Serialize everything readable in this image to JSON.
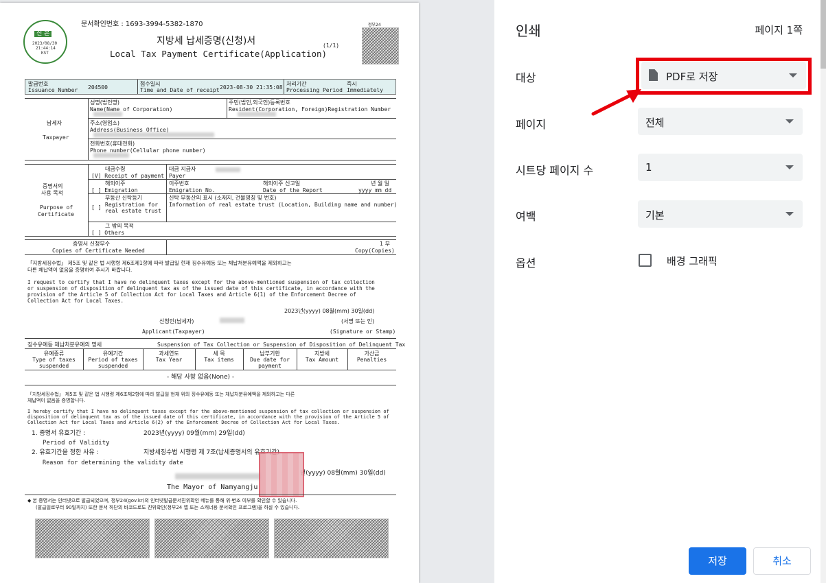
{
  "print": {
    "title": "인쇄",
    "page_count": "페이지 1쪽",
    "destination": {
      "label": "대상",
      "value": "PDF로 저장"
    },
    "pages": {
      "label": "페이지",
      "value": "전체"
    },
    "pages_per_sheet": {
      "label": "시트당 페이지 수",
      "value": "1"
    },
    "margins": {
      "label": "여백",
      "value": "기본"
    },
    "options": {
      "label": "옵션",
      "checkbox_label": "배경 그래픽"
    },
    "save_button": "저장",
    "cancel_button": "취소",
    "highlight_color": "#e8000b",
    "accent_color": "#1a73e8"
  },
  "doc": {
    "doc_number": "문서확인번호 :  1693-3994-5382-1870",
    "title_ko": "지방세 납세증명(신청)서",
    "title_en": "Local Tax Payment Certificate(Application)",
    "page_of": "(1/1)",
    "seal": {
      "top": "진 본",
      "date": "2023/08/30",
      "time": "21:44:14",
      "tz": "KST"
    },
    "gov24": "정부24",
    "issuance_number_ko": "발급번호",
    "issuance_number_en": "Issuance Number",
    "issuance_number": "204500",
    "receipt_ko": "접수일시",
    "receipt_en": "Time and Date of receipt",
    "receipt_time": "2023-08-30 21:35:08",
    "period_ko": "처리기간",
    "period_en": "Processing Period",
    "period_ko_val": "즉시",
    "period_en_val": "Immediately",
    "taxpayer_ko": "납세자",
    "taxpayer_en": "Taxpayer",
    "name_ko": "성명(법인명)",
    "name_en": "Name(Name of Corporation)",
    "reg_ko": "주민(법인,외국인)등록번호",
    "reg_en": "Resident(Corporation, Foreign)Registration Number",
    "addr_ko": "주소(영업소)",
    "addr_en": "Address(Business Office)",
    "phone_ko": "전화번호(휴대전화)",
    "phone_en": "Phone number(Cellular phone number)",
    "purpose_ko1": "증명서의",
    "purpose_ko2": "사용 목적",
    "purpose_en1": "Purpose of",
    "purpose_en2": "Certificate",
    "receipt_pay_ko": "대금수령",
    "receipt_pay_en": "[V] Receipt of payment",
    "payer_ko": "대금 지급자",
    "payer_en": "Payer",
    "emig_ko": "해외이주",
    "emig_en": "[ ] Emigration",
    "emig_no_ko": "이주번호",
    "emig_no_en": "Emigration No.",
    "emig_date_ko": "해외이주 신고일",
    "emig_date_en": "Date of the Report",
    "ymd_ko": "년 월 일",
    "ymd_en": "yyyy  mm  dd",
    "trust_ko": "부동산 신탁등기",
    "trust_en1": "Registration for",
    "trust_en2": "real estate trust",
    "trust_bracket": "[ ]",
    "trust_info_ko": "신탁 부동산의 표시 (소재지, 건물명칭 및 번호)",
    "trust_info_en": "Information of real estate trust (Location, Building name and number)",
    "others_ko": "그 밖의 목적",
    "others_en": "[ ] Others",
    "copies_ko": "증명서 신청부수",
    "copies_en": "Copies of Certificate Needed",
    "copies_ko_val": "1 부",
    "copies_en_val": "Copy(Copies)",
    "req_ko1": "「지방세징수법」 제5조 및 같은 법 시행령 제6조제1항에 따라 발급일 현재 징수유예등 또는 체납처분유예액을 제외하고는",
    "req_ko2": "다른 체납액이 없음을 증명하여 주시기 바랍니다.",
    "req_en1": "  I request to certify that I have no delinquent taxes except for the above-mentioned suspension of tax collection",
    "req_en2": "or suspension of disposition of delinquent tax as of the issued date of this certificate, in accordance with the",
    "req_en3": "provision of the Article 5 of Collection Act for Local Taxes and Article 6(1) of the Enforcement Decree of",
    "req_en4": "Collection Act for Local Taxes.",
    "app_date": "2023년(yyyy) 08월(mm) 30일(dd)",
    "applicant_ko": "신청인(납세자)",
    "applicant_en": "Applicant(Taxpayer)",
    "sign_ko": "(서명 또는 인)",
    "sign_en": "(Signature or Stamp)",
    "susp_ko": "징수유예등 체납처분유예의 명세",
    "susp_en": "Suspension of Tax Collection or Suspension of Disposition of Delinquent Tax",
    "cols": [
      {
        "ko": "유예종류",
        "en1": "Type of taxes",
        "en2": "suspended"
      },
      {
        "ko": "유예기간",
        "en1": "Period of taxes",
        "en2": "suspended"
      },
      {
        "ko": "과세연도",
        "en1": "Tax Year",
        "en2": ""
      },
      {
        "ko": "세 목",
        "en1": "Tax items",
        "en2": ""
      },
      {
        "ko": "납부기한",
        "en1": "Due date for",
        "en2": "payment"
      },
      {
        "ko": "지방세",
        "en1": "Tax Amount",
        "en2": ""
      },
      {
        "ko": "가산금",
        "en1": "Penalties",
        "en2": ""
      }
    ],
    "none_text": "- 해당 사항 없음(None) -",
    "cert_ko1": "「지방세징수법」 제5조 및 같은 법 시행령 제6조제2항에 따라 발급일 현재 위의 징수유예등 또는 체납처분유예액을 제외하고는 다른",
    "cert_ko2": "체납액이 없음을 증명합니다.",
    "cert_en1": "  I hereby certify that I have no delinquent taxes except for the above-mentioned suspension of tax collection or suspension of",
    "cert_en2": "disposition of delinquent tax as of the issued date of this certificate, in accordance with the provision of the Article 5 of",
    "cert_en3": "Collection Act for Local Taxes and Article 6(2) of the Enforcement Decree of Collection Act for Local Taxes.",
    "validity_ko": "1. 증명서 유효기간 :",
    "validity_val": "2023년(yyyy) 09월(mm) 29일(dd)",
    "validity_en": "Period of Validity",
    "reason_ko": "2. 유효기간을 정한 사유 :",
    "reason_val": "지방세징수법 시행령 제 7조(납세증명서의 유효기간)",
    "reason_en": "Reason for determining the validity date",
    "issue_date": "년(yyyy) 08월(mm) 30일(dd)",
    "mayor": "The Mayor of Namyangju",
    "notice1": "◆ 본 증명서는 인터넷으로 발급되었으며, 정부24(gov.kr)의 인터넷발급문서진위확인 메뉴를 통해 위·변조 여부를 확인할 수 있습니다.",
    "notice2": "(발급일로부터 90일까지) 또한 문서 하단의 바코드로도 진위확인(정부24 앱 또는 스캐너용 문서확인 프로그램)을 하실 수 있습니다."
  }
}
